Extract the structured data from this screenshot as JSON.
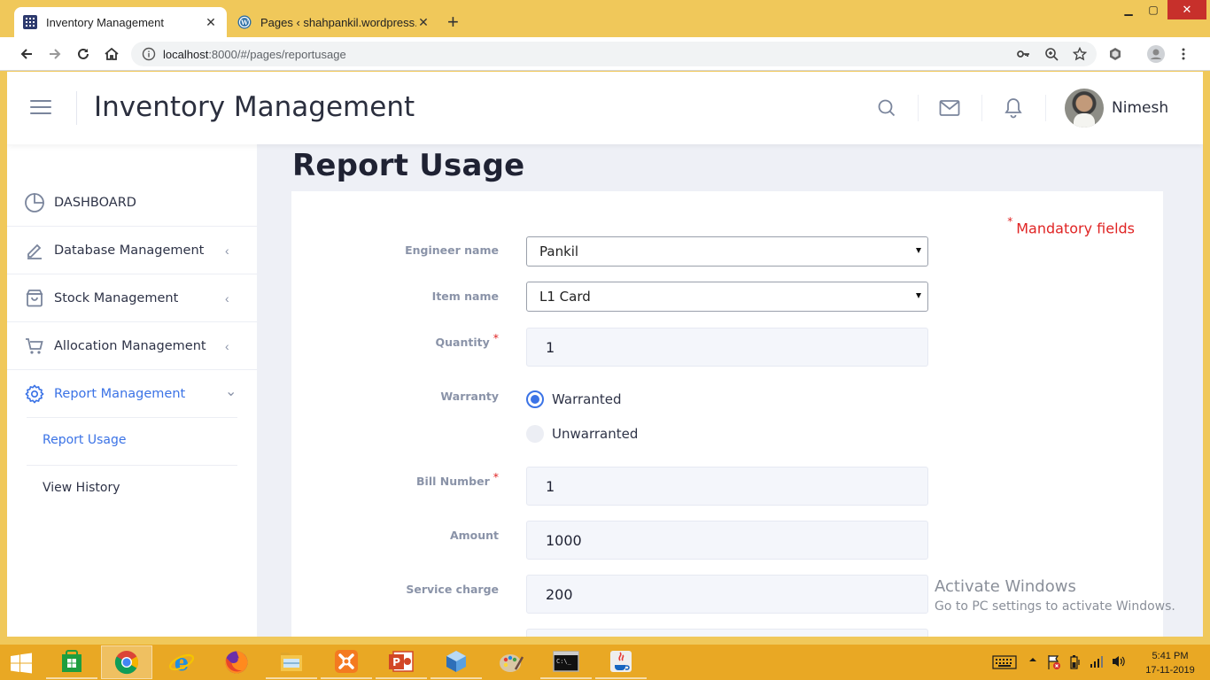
{
  "browser": {
    "tabs": [
      {
        "title": "Inventory Management",
        "active": true,
        "favicon": "app-grid-icon"
      },
      {
        "title": "Pages ‹ shahpankil.wordpress.com",
        "active": false,
        "favicon": "wordpress-icon"
      }
    ],
    "new_tab": "+",
    "url_host": "localhost",
    "url_path": ":8000/#/pages/reportusage",
    "colors": {
      "titlebar": "#f0c85a",
      "close": "#c7302b"
    }
  },
  "header": {
    "title": "Inventory Management",
    "user_name": "Nimesh",
    "icons": [
      "search-icon",
      "mail-icon",
      "bell-icon"
    ]
  },
  "sidebar": {
    "items": [
      {
        "label": "DASHBOARD",
        "icon": "pie-chart-icon",
        "has_chevron": false
      },
      {
        "label": "Database Management",
        "icon": "pencil-icon",
        "has_chevron": true
      },
      {
        "label": "Stock Management",
        "icon": "box-icon",
        "has_chevron": true
      },
      {
        "label": "Allocation Management",
        "icon": "cart-icon",
        "has_chevron": true
      },
      {
        "label": "Report Management",
        "icon": "gear-icon",
        "has_chevron": true,
        "active": true
      }
    ],
    "sub_items": [
      {
        "label": "Report Usage",
        "active": true
      },
      {
        "label": "View History",
        "active": false
      }
    ],
    "chevron_left": "‹",
    "chevron_down": "⌄"
  },
  "page": {
    "title": "Report Usage",
    "mandatory_star": "*",
    "mandatory_text": "Mandatory fields",
    "accent": "#3b73e6",
    "required_color": "#e02424"
  },
  "form": {
    "engineer": {
      "label": "Engineer name",
      "value": "Pankil"
    },
    "item": {
      "label": "Item name",
      "value": "L1 Card"
    },
    "quantity": {
      "label": "Quantity",
      "value": "1",
      "required": "*"
    },
    "warranty": {
      "label": "Warranty",
      "options": [
        "Warranted",
        "Unwarranted"
      ],
      "selected": "Warranted"
    },
    "bill_number": {
      "label": "Bill Number",
      "value": "1",
      "required": "*"
    },
    "amount": {
      "label": "Amount",
      "value": "1000"
    },
    "service_charge": {
      "label": "Service charge",
      "value": "200"
    }
  },
  "watermark": {
    "line1": "Activate Windows",
    "line2": "Go to PC settings to activate Windows."
  },
  "taskbar": {
    "apps": [
      "store-icon",
      "chrome-icon",
      "ie-icon",
      "firefox-icon",
      "file-explorer-icon",
      "xampp-icon",
      "powerpoint-icon",
      "virtualbox-icon",
      "paint-icon",
      "cmd-icon",
      "java-icon"
    ],
    "time": "5:41 PM",
    "date": "17-11-2019"
  }
}
